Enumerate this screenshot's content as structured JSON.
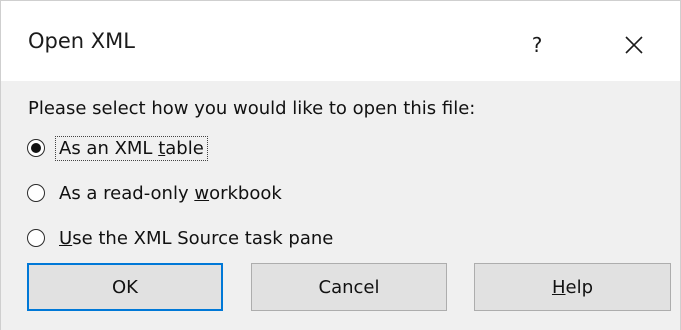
{
  "dialog": {
    "title": "Open XML",
    "help_glyph": "?",
    "close_glyph": "close-icon"
  },
  "prompt": "Please select how you would like to open this file:",
  "options": [
    {
      "before": "As an XML ",
      "mnemonic": "t",
      "after": "able",
      "selected": true
    },
    {
      "before": "As a read-only ",
      "mnemonic": "w",
      "after": "orkbook",
      "selected": false
    },
    {
      "before": "",
      "mnemonic": "U",
      "after": "se the XML Source task pane",
      "selected": false
    }
  ],
  "buttons": {
    "ok": "OK",
    "cancel": "Cancel",
    "help_mnemonic": "H",
    "help_rest": "elp"
  },
  "colors": {
    "default_button_border": "#0078d7",
    "button_face": "#e1e1e1",
    "dialog_face": "#f0f0f0"
  }
}
